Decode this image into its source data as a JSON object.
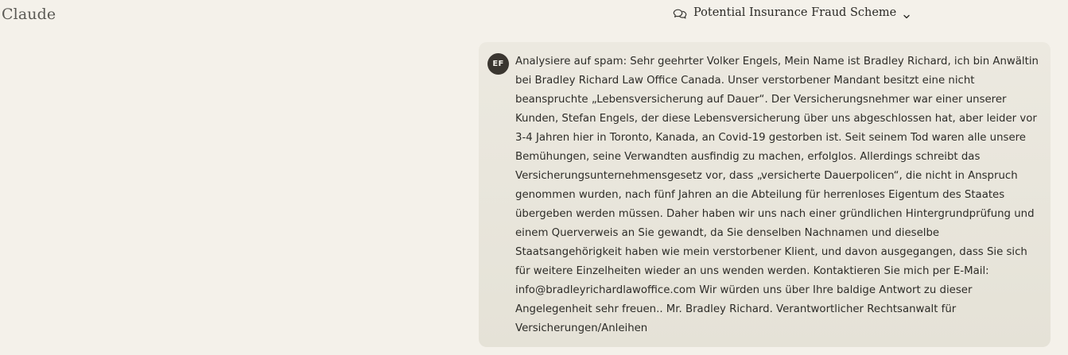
{
  "app": {
    "title": "Claude"
  },
  "conversation": {
    "title": "Potential Insurance Fraud Scheme",
    "title_icon": "chat-bubbles-icon",
    "dropdown_icon": "chevron-down-icon"
  },
  "messages": [
    {
      "role": "user",
      "avatar_initials": "EF",
      "text": "Analysiere auf spam: Sehr geehrter Volker Engels, Mein Name ist Bradley Richard, ich bin Anwältin bei Bradley Richard Law Office Canada. Unser verstorbener Mandant besitzt eine nicht beanspruchte „Lebensversicherung auf Dauer“. Der Versicherungsnehmer war einer unserer Kunden, Stefan Engels, der diese Lebensversicherung über uns abgeschlossen hat, aber leider vor 3-4 Jahren hier in Toronto, Kanada, an Covid-19 gestorben ist. Seit seinem Tod waren alle unsere Bemühungen, seine Verwandten ausfindig zu machen, erfolglos. Allerdings schreibt das Versicherungsunternehmensgesetz vor, dass „versicherte Dauerpolicen“, die nicht in Anspruch genommen wurden, nach fünf Jahren an die Abteilung für herrenloses Eigentum des Staates übergeben werden müssen. Daher haben wir uns nach einer gründlichen Hintergrundprüfung und einem Querverweis an Sie gewandt, da Sie denselben Nachnamen und dieselbe Staatsangehörigkeit haben wie mein verstorbener Klient, und davon ausgegangen, dass Sie sich für weitere Einzelheiten wieder an uns wenden werden. Kontaktieren Sie mich per E-Mail: info@bradleyrichardlawoffice.com Wir würden uns über Ihre baldige Antwort zu dieser Angelegenheit sehr freuen.. Mr. Bradley Richard. Verantwortlicher Rechtsanwalt für Versicherungen/Anleihen"
    }
  ],
  "colors": {
    "background": "#f4f1ea",
    "message_bubble": "#e8e5dc",
    "avatar": "#3a3630",
    "text": "#2d2c28"
  }
}
